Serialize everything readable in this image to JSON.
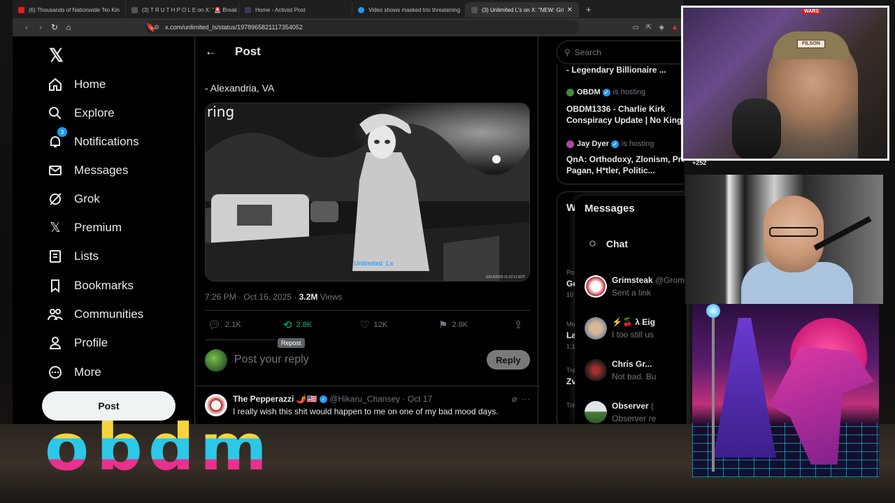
{
  "browser": {
    "tabs": [
      {
        "title": "(6) Thousands of Nationwide 'No Kin",
        "color": "#e02020"
      },
      {
        "title": "(3) T R U T H P O L E on X: \"🚨 Break",
        "color": "#111111"
      },
      {
        "title": "Home - Activist Post",
        "color": "#2a2a3a"
      },
      {
        "title": "Video shows masked trio threatening",
        "color": "#1d9bf0"
      },
      {
        "title": "(3) Unlimited L's on X: \"NEW: Gri",
        "color": "#111111"
      }
    ],
    "url": "x.com/unlimited_ls/status/1978965821117354052"
  },
  "nav": {
    "items": [
      {
        "label": "Home",
        "icon": "home-icon"
      },
      {
        "label": "Explore",
        "icon": "search-icon"
      },
      {
        "label": "Notifications",
        "icon": "bell-icon",
        "badge": "3"
      },
      {
        "label": "Messages",
        "icon": "mail-icon"
      },
      {
        "label": "Grok",
        "icon": "grok-icon"
      },
      {
        "label": "Premium",
        "icon": "x-icon"
      },
      {
        "label": "Lists",
        "icon": "list-icon"
      },
      {
        "label": "Bookmarks",
        "icon": "bookmark-icon"
      },
      {
        "label": "Communities",
        "icon": "communities-icon"
      },
      {
        "label": "Profile",
        "icon": "person-icon"
      },
      {
        "label": "More",
        "icon": "more-icon"
      }
    ],
    "post_label": "Post"
  },
  "post": {
    "header": "Post",
    "location": "- Alexandria, VA",
    "media_brand": "ring",
    "media_watermark": "Unlimited_Ls",
    "media_timestamp": "10/14/2025 11:22:11 EDT",
    "time": "7:26 PM · Oct 16, 2025 · ",
    "views_count": "3.2M",
    "views_label": " Views",
    "replies": "2.1K",
    "reposts": "2.8K",
    "likes": "12K",
    "bookmarks": "2.8K",
    "tooltip": "Repost",
    "reply_placeholder": "Post your reply",
    "reply_button": "Reply"
  },
  "reply": {
    "name": "The Pepperazzi 🌶️🇺🇸",
    "handle": "@Hikaru_Chansey · Oct 17",
    "text": "I really wish this shit would happen to me on one of my bad mood days."
  },
  "search": {
    "placeholder": "Search"
  },
  "spaces": [
    {
      "title": "- Legendary Billionaire ..."
    },
    {
      "host": "OBDM",
      "hosting": "is hosting",
      "title": "OBDM1336 - Charlie Kirk Conspiracy Update | No King"
    },
    {
      "host": "Jay Dyer",
      "hosting": "is hosting",
      "title": "QnA: Orthodoxy, Zlonism, Prot, Pagan, H*tler, Politic..."
    }
  ],
  "trends": [
    {
      "label": "Po",
      "value": "Ge",
      "sub": "10"
    },
    {
      "label": "Mo",
      "value": "La",
      "sub": "1,1"
    },
    {
      "label": "Tre",
      "value": "Zv",
      "sub": ""
    },
    {
      "label": "Tre",
      "value": "",
      "sub": ""
    }
  ],
  "trends_header": "W",
  "messages": {
    "title": "Messages",
    "chat_label": "Chat",
    "conversations": [
      {
        "name": "Grimsteak",
        "handle": " @Grom",
        "preview": "Sent a link",
        "color": "#c0202a"
      },
      {
        "name": "⚡🍒 λ Eig",
        "handle": "",
        "preview": "I too still us",
        "color": "#7a8a9a"
      },
      {
        "name": "Chris Gr...",
        "handle": "",
        "preview": "Not bad. Bu",
        "color": "#3a2a2a"
      },
      {
        "name": "Observer",
        "handle": " (",
        "preview": "Observer re",
        "color": "#5a8a5a"
      }
    ]
  },
  "overlays": {
    "listener_count": "+252",
    "cap_text": "FILSON",
    "shelf_text": "WARS",
    "brand_logo": "obdm"
  }
}
